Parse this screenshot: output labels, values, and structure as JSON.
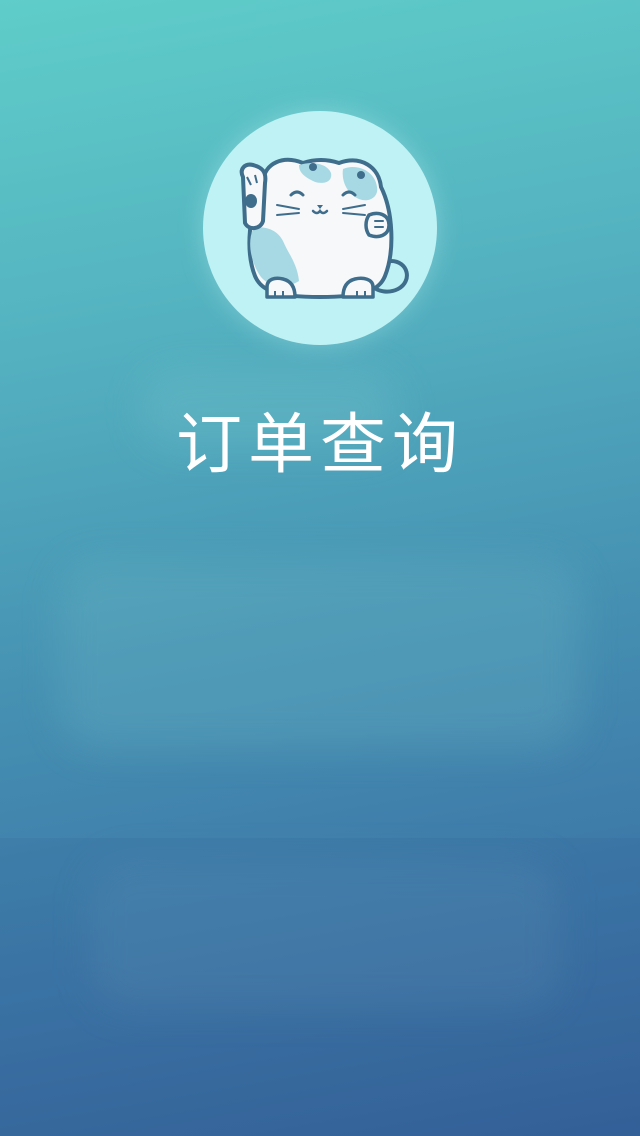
{
  "app": {
    "title": "订单查询",
    "logo_icon": "lucky-cat-icon",
    "logo_bg_color": "#bff2f4",
    "title_color": "#ffffff"
  }
}
